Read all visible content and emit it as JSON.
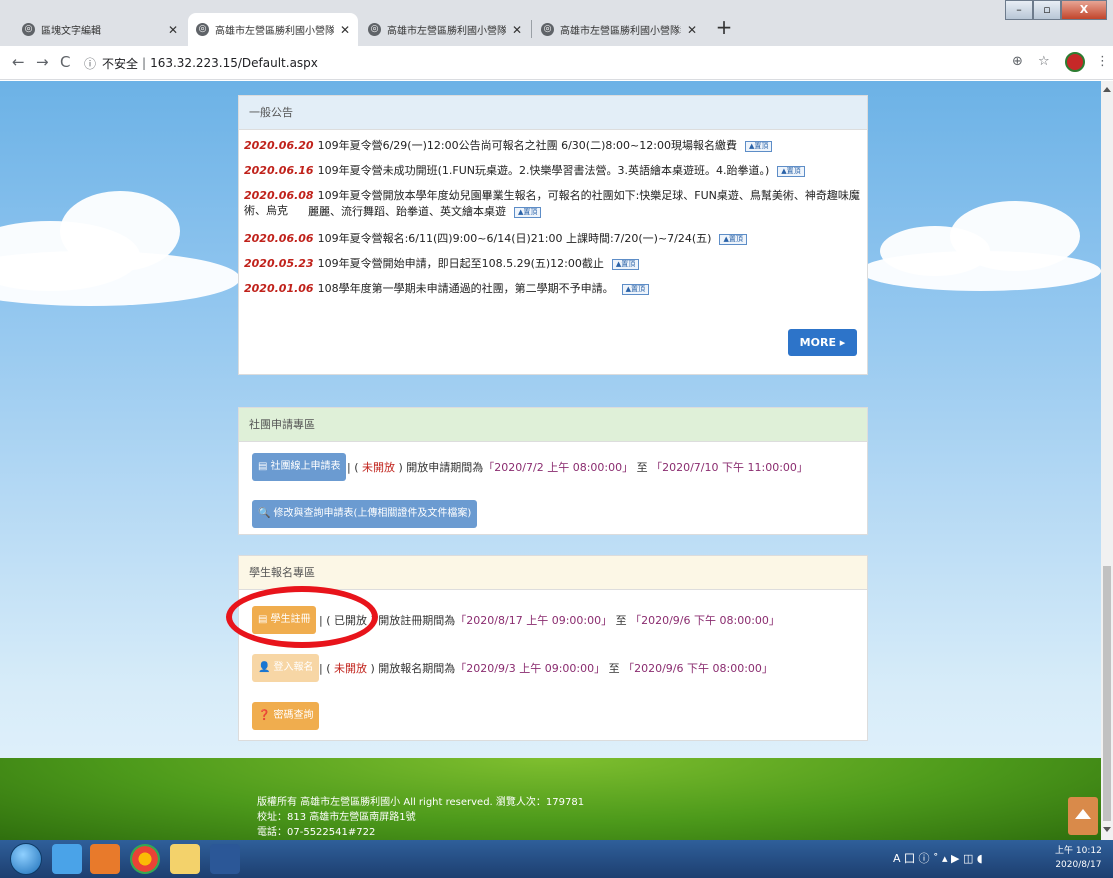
{
  "browser": {
    "tabs": [
      {
        "label": "區塊文字編輯",
        "active": false
      },
      {
        "label": "高雄市左營區勝利國小營隊報名",
        "active": true
      },
      {
        "label": "高雄市左營區勝利國小營隊報名",
        "active": false
      },
      {
        "label": "高雄市左營區勝利國小營隊報名",
        "active": false
      }
    ],
    "new_tab": "+",
    "security": "不安全",
    "url": "163.32.223.15/Default.aspx",
    "win_buttons": [
      "–",
      "▫",
      "X"
    ]
  },
  "announcements": {
    "heading": "一般公告",
    "tag_label": "▲置頂",
    "items": [
      {
        "date": "2020.06.20",
        "text": "109年夏令營6/29(一)12:00公告尚可報名之社團 6/30(二)8:00~12:00現場報名繳費"
      },
      {
        "date": "2020.06.16",
        "text": "109年夏令營未成功開班(1.FUN玩桌遊。2.快樂學習書法營。3.英語繪本桌遊班。4.跆拳道。)"
      },
      {
        "date": "2020.06.08",
        "text": "109年夏令營開放本學年度幼兒園畢業生報名，可報名的社團如下:快樂足球、FUN桌遊、鳥幫美術、神奇趣味魔術、烏克",
        "text2": "麗麗、流行舞蹈、跆拳道、英文繪本桌遊"
      },
      {
        "date": "2020.06.06",
        "text": "109年夏令營報名:6/11(四)9:00~6/14(日)21:00 上課時間:7/20(一)~7/24(五)"
      },
      {
        "date": "2020.05.23",
        "text": "109年夏令營開始申請，即日起至108.5.29(五)12:00截止"
      },
      {
        "date": "2020.01.06",
        "text": "108學年度第一學期未申請通過的社團，第二學期不予申請。"
      }
    ],
    "more_label": "MORE ▸"
  },
  "club_apply": {
    "heading": "社團申請專區",
    "apply_btn": "社團線上申請表",
    "status_closed": "未開放",
    "period_prefix": "開放申請期間為",
    "start": "「2020/7/2 上午 08:00:00」",
    "to": "至",
    "end": "「2020/7/10 下午 11:00:00」",
    "query_btn": "修改與查詢申請表(上傳相關證件及文件檔案)"
  },
  "student_signup": {
    "heading": "學生報名專區",
    "register_btn": "學生註冊",
    "register_status": "已開放",
    "register_prefix": "開放註冊期間為",
    "register_start": "「2020/8/17 上午 09:00:00」",
    "to": "至",
    "register_end": "「2020/9/6 下午 08:00:00」",
    "login_btn": "登入報名",
    "login_status": "未開放",
    "login_prefix": "開放報名期間為",
    "login_start": "「2020/9/3 上午 09:00:00」",
    "login_end": "「2020/9/6 下午 08:00:00」",
    "password_btn": "密碼查詢"
  },
  "footer": {
    "copyright": "版權所有 高雄市左營區勝利國小 All right reserved. 瀏覽人次：179781",
    "address": "校址：813 高雄市左營區南屏路1號",
    "phone": "電話：07-5522541#722"
  },
  "taskbar": {
    "tray": "A 囗 ⓘ ˚ ▴ ▶ ◫ ◖",
    "time": "上午 10:12",
    "date": "2020/8/17"
  },
  "colors": {
    "date_red": "#c0221b",
    "more_blue": "#2d74c9",
    "orange_btn": "#f0ad4e",
    "highlight_circle": "#e8141b"
  }
}
